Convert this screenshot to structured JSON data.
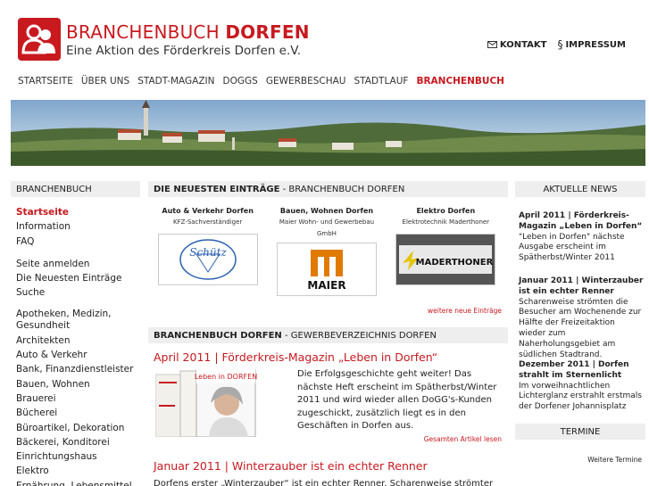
{
  "header": {
    "brand_main": "BRANCHENBUCH ",
    "brand_bold": "DORFEN",
    "subtitle": "Eine Aktion des Förderkreis Dorfen e.V.",
    "links": [
      {
        "icon": "mail-icon",
        "label": "KONTAKT"
      },
      {
        "icon": "paragraph-icon",
        "label": "IMPRESSUM"
      }
    ]
  },
  "nav": {
    "items": [
      "STARTSEITE",
      "ÜBER UNS",
      "STADT-MAGAZIN",
      "DOGGS",
      "GEWERBESCHAU",
      "STADTLAUF",
      "BRANCHENBUCH"
    ],
    "active": "BRANCHENBUCH"
  },
  "sidebar": {
    "heading": "BRANCHENBUCH",
    "group1": [
      "Startseite",
      "Information",
      "FAQ"
    ],
    "group2": [
      "Seite anmelden",
      "Die Neuesten Einträge",
      "Suche"
    ],
    "categories": [
      "Apotheken, Medizin, Gesundheit",
      "Architekten",
      "Auto & Verkehr",
      "Bank, Finanzdienstleister",
      "Bauen, Wohnen",
      "Brauerei",
      "Bücherei",
      "Büroartikel, Dekoration",
      "Bäckerei, Konditorei",
      "Einrichtungshaus",
      "Elektro",
      "Ernährung, Lebensmittel"
    ]
  },
  "newest": {
    "heading_bold": "DIE NEUESTEN EINTRÄGE",
    "heading_rest": " - BRANCHENBUCH DORFEN",
    "entries": [
      {
        "title": "Auto & Verkehr Dorfen",
        "subtitle": "KFZ-Sachverständiger",
        "logo_text": "Schütz"
      },
      {
        "title": "Bauen, Wohnen Dorfen",
        "subtitle": "Maier Wohn- und Gewerbebau GmbH",
        "logo_text": "MAIER"
      },
      {
        "title": "Elektro Dorfen",
        "subtitle": "Elektrotechnik Maderthoner",
        "logo_text": "MADERTHONER"
      }
    ],
    "more": "weitere neue Einträge"
  },
  "directory": {
    "heading_bold": "BRANCHENBUCH DORFEN",
    "heading_rest": " - GEWERBEVERZEICHNIS DORFEN",
    "article1_title": "April 2011 | Förderkreis-Magazin „Leben in Dorfen“",
    "article1_text": "Die Erfolgsgeschichte geht weiter! Das nächste Heft erscheint im Spätherbst/Winter 2011 und wird wieder allen DoGG's-Kunden zugeschickt, zusätzlich liegt es in den Geschäften in Dorfen aus.",
    "magazine_title": "Leben in DORFEN",
    "read_more": "Gesamten Artikel lesen",
    "article2_title": "Januar 2011 | Winterzauber ist ein echter Renner",
    "article2_text": "Dorfens erster „Winterzauber“ ist ein echter Renner. Scharenweise strömten die"
  },
  "news": {
    "heading": "AKTUELLE NEWS",
    "items": [
      {
        "title": "April 2011 | Förderkreis-Magazin „Leben in Dorfen“",
        "text": "\"Leben in Dorfen\" nächste Ausgabe erscheint im Spätherbst/Winter 2011"
      },
      {
        "title": "Januar 2011 | Winterzauber ist ein echter Renner",
        "text": "Scharenweise strömten die Besucher am Wochenende zur Hälfte der Freizeitaktion wieder zum Naherholungsgebiet am südlichen Stadtrand."
      },
      {
        "title": "Dezember 2011 | Dorfen strahlt im Sternenlicht",
        "text": "Im vorweihnachtlichen Lichterglanz erstrahlt erstmals der Dorfener Johannisplatz"
      }
    ],
    "termine_heading": "TERMINE",
    "termine_more": "Weitere Termine"
  },
  "colors": {
    "accent": "#c8191f",
    "bar": "#eeeeee"
  }
}
